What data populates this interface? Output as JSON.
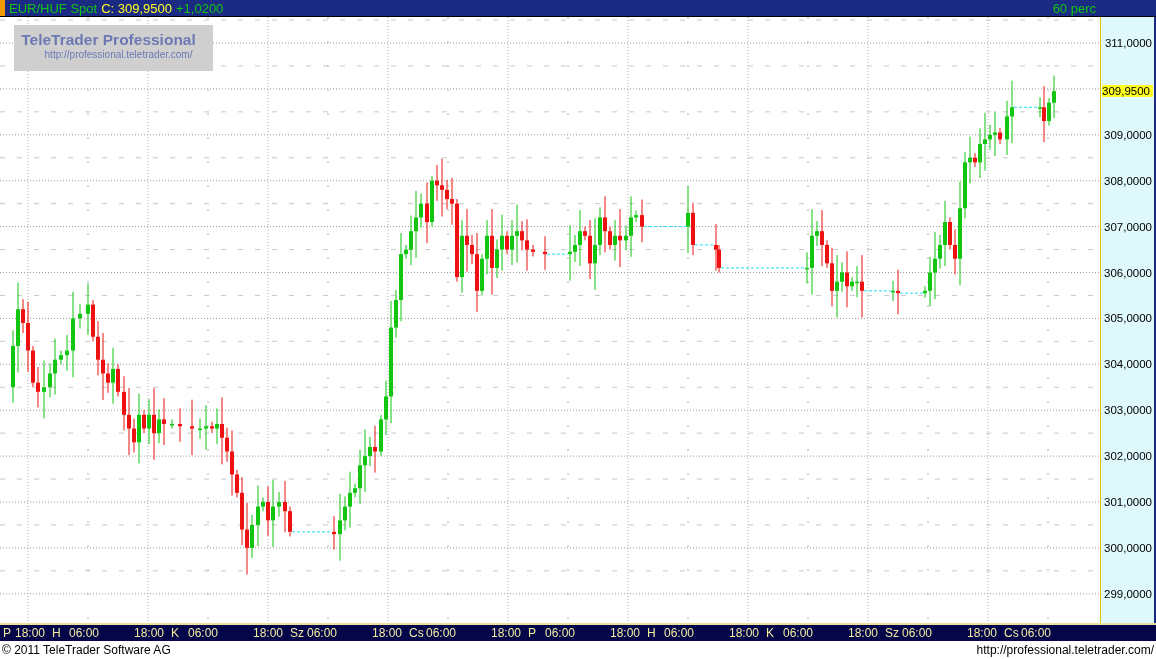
{
  "header": {
    "symbol": "EUR/HUF Spot",
    "close_label": "C: 309,9500",
    "change": "+1,0200",
    "interval": "60 perc"
  },
  "logo": {
    "title": "TeleTrader Professional",
    "url": "http://professional.teletrader.com/"
  },
  "price_axis": {
    "ticks": [
      "311,0000",
      "309,0000",
      "308,0000",
      "307,0000",
      "306,0000",
      "305,0000",
      "304,0000",
      "303,0000",
      "302,0000",
      "301,0000",
      "300,0000",
      "299,0000"
    ],
    "last_price": "309,9500"
  },
  "time_axis": {
    "labels": [
      "P",
      "18:00",
      "H",
      "06:00",
      "18:00",
      "K",
      "06:00",
      "18:00",
      "Sz",
      "06:00",
      "18:00",
      "Cs",
      "06:00",
      "18:00",
      "P",
      "06:00",
      "18:00",
      "H",
      "06:00",
      "18:00",
      "K",
      "06:00",
      "18:00",
      "Sz",
      "06:00",
      "18:00",
      "Cs",
      "06:00"
    ]
  },
  "footer": {
    "copyright": "© 2011 TeleTrader Software AG",
    "url": "http://professional.teletrader.com/"
  }
}
